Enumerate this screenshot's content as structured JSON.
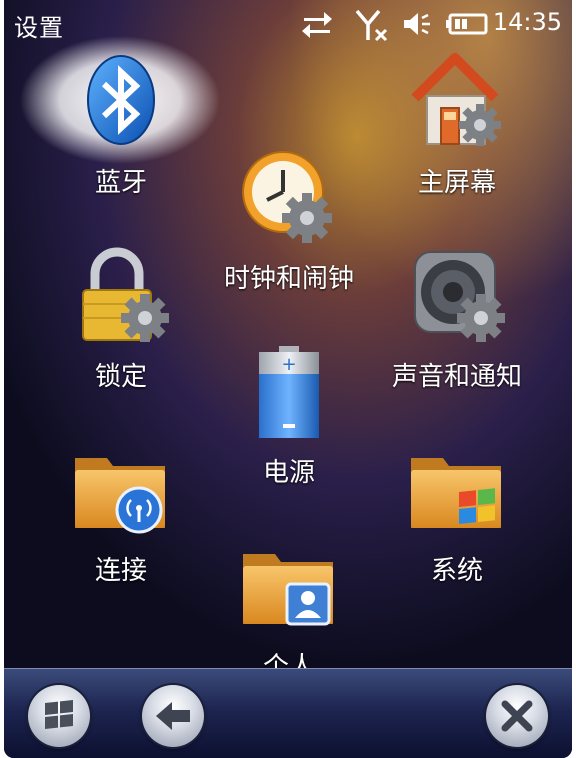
{
  "status_bar": {
    "title": "设置",
    "time": "14:35",
    "icons": [
      "sync-arrows-icon",
      "no-signal-icon",
      "speaker-icon",
      "battery-icon"
    ]
  },
  "tiles": {
    "bluetooth": {
      "label": "蓝牙",
      "icon": "bluetooth-icon"
    },
    "home_screen": {
      "label": "主屏幕",
      "icon": "house-gear-icon"
    },
    "clock": {
      "label": "时钟和闹钟",
      "icon": "clock-gear-icon"
    },
    "lock": {
      "label": "锁定",
      "icon": "padlock-gear-icon"
    },
    "sounds": {
      "label": "声音和通知",
      "icon": "speaker-gear-icon"
    },
    "power": {
      "label": "电源",
      "icon": "battery-icon"
    },
    "connections": {
      "label": "连接",
      "icon": "folder-wireless-icon"
    },
    "system": {
      "label": "系统",
      "icon": "folder-windows-icon"
    },
    "personal": {
      "label": "个人",
      "icon": "folder-contact-icon"
    }
  },
  "bottom_bar": {
    "buttons": [
      "start-button",
      "back-button",
      "close-button"
    ]
  },
  "colors": {
    "folder": "#e8a040",
    "gear": "#8c8f94",
    "battery_blue": "#3d8be0",
    "bottom_bar": "#1d2550"
  }
}
